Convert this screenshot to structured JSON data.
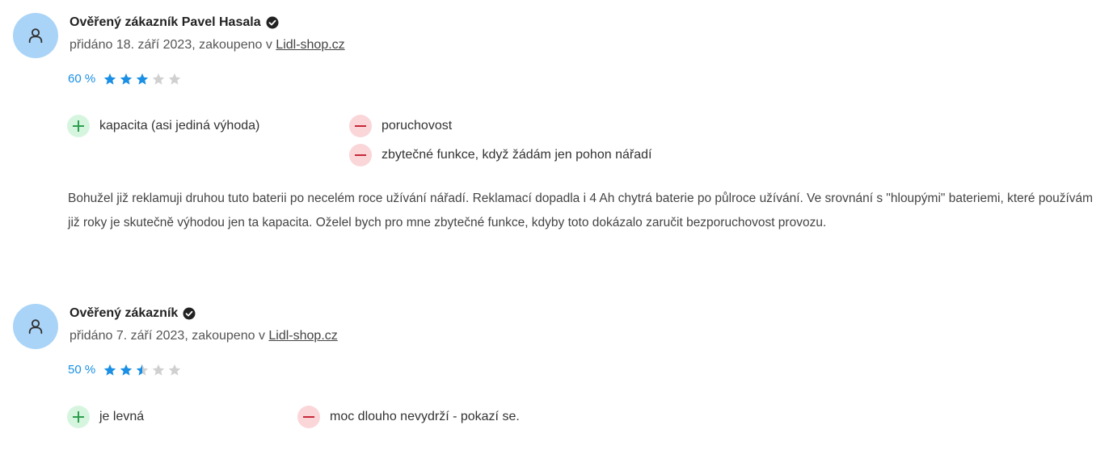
{
  "reviews": [
    {
      "name": "Ověřený zákazník Pavel Hasala",
      "meta_prefix": "přidáno 18. září 2023, zakoupeno v ",
      "shop": "Lidl-shop.cz",
      "rating_text": "60 %",
      "rating_stars": 3,
      "pros": [
        "kapacita (asi jediná výhoda)"
      ],
      "cons": [
        "poruchovost",
        "zbytečné funkce, když žádám jen pohon nářadí"
      ],
      "text": "Bohužel již reklamuji druhou tuto baterii po necelém roce užívání nářadí. Reklamací dopadla i 4 Ah chytrá baterie po půlroce užívání. Ve srovnání s \"hloupými\" bateriemi, které používám již roky je skutečně výhodou jen ta kapacita. Oželel bych pro mne zbytečné funkce, kdyby toto dokázalo zaručit bezporuchovost provozu."
    },
    {
      "name": "Ověřený zákazník",
      "meta_prefix": "přidáno 7. září 2023, zakoupeno v ",
      "shop": "Lidl-shop.cz",
      "rating_text": "50 %",
      "rating_stars": 2.5,
      "pros": [
        "je levná"
      ],
      "cons": [
        "moc dlouho nevydrží - pokazí se."
      ]
    }
  ],
  "colors": {
    "accent": "#1a8fe3",
    "star_filled": "#1a8fe3",
    "star_empty": "#d0d0d0",
    "avatar_bg": "#a9d4f7",
    "plus_bg": "#d6f5df",
    "plus_fg": "#2e9e4f",
    "minus_bg": "#fad6d9",
    "minus_fg": "#c62838"
  },
  "icons": {
    "avatar": "user-icon",
    "verified": "verified-check-icon",
    "star": "star-icon",
    "pro": "plus-icon",
    "con": "minus-icon"
  }
}
